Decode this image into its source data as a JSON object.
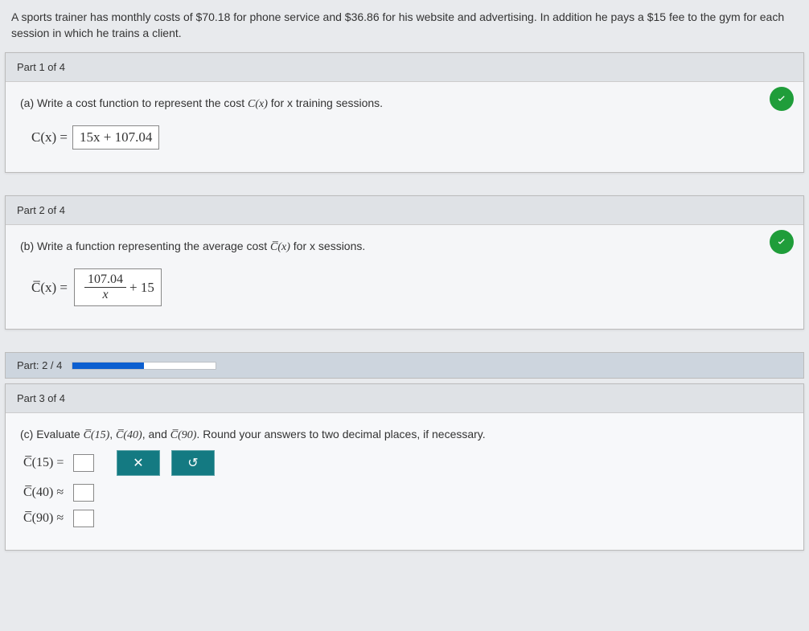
{
  "problem_text": "A sports trainer has monthly costs of $70.18 for phone service and $36.86 for his website and advertising. In addition he pays a $15 fee to the gym for each session in which he trains a client.",
  "part1": {
    "header": "Part 1 of 4",
    "prompt_pre": "(a) Write a cost function to represent the cost ",
    "prompt_fn": "C(x)",
    "prompt_post": " for x training sessions.",
    "lhs": "C(x) =",
    "answer": "15x + 107.04"
  },
  "part2": {
    "header": "Part 2 of 4",
    "prompt_pre": "(b) Write a function representing the average cost ",
    "prompt_fn": "C̅(x)",
    "prompt_post": " for x sessions.",
    "lhs": "C̅(x) =",
    "answer_num": "107.04",
    "answer_den": "x",
    "answer_plus": " + 15"
  },
  "progress": {
    "label": "Part: 2 / 4",
    "percent": 50
  },
  "part3": {
    "header": "Part 3 of 4",
    "prompt_pre": "(c) Evaluate ",
    "e1": "C̅(15)",
    "e2": "C̅(40)",
    "eand": ", and ",
    "e3": "C̅(90)",
    "prompt_post": ". Round your answers to two decimal places, if necessary.",
    "rows": [
      {
        "label": "C̅(15) ="
      },
      {
        "label": "C̅(40) ≈"
      },
      {
        "label": "C̅(90) ≈"
      }
    ],
    "clear_icon": "✕",
    "undo_icon": "↺"
  }
}
